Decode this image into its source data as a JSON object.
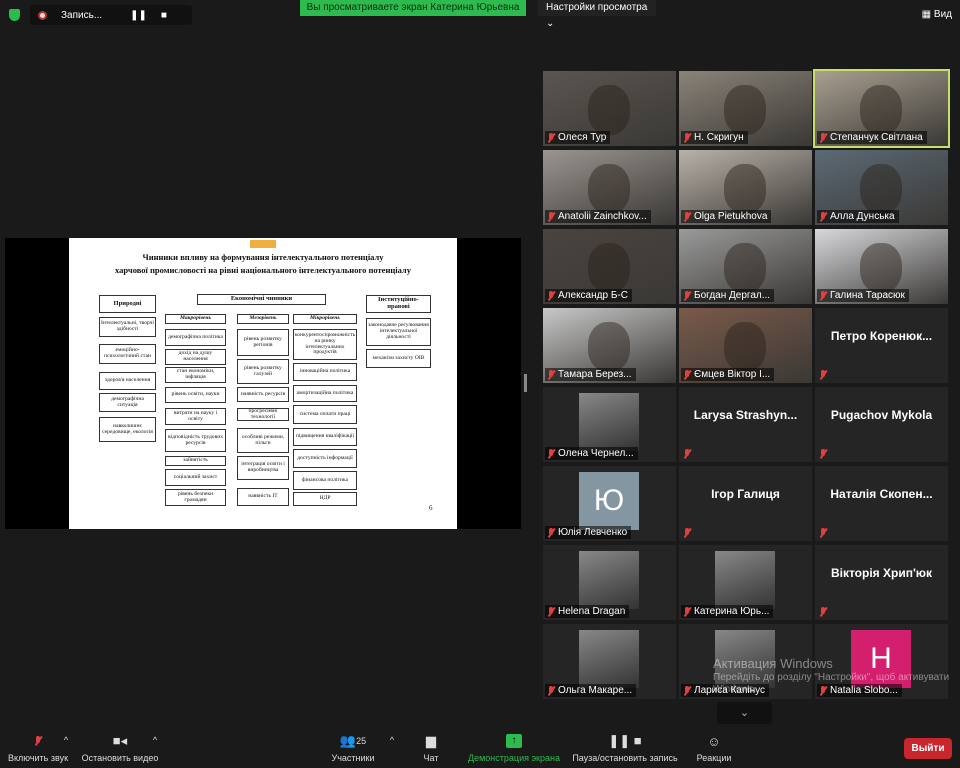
{
  "topbar": {
    "recording": "Запись...",
    "banner": "Вы просматриваете экран Катерина Юрьевна",
    "view_settings": "Настройки просмотра",
    "view": "Вид"
  },
  "slide": {
    "title1": "Чинники впливу на формування інтелектуального потенціалу",
    "title2": "харчової промисловості на рівні національного інтелектуального потенціалу",
    "page": "6",
    "boxes": [
      "Природні",
      "Економічні чинники",
      "Інституційно-правові",
      "Інтелектуальні, творчі здібності",
      "емоційно-психологічний стан",
      "здоров'я населення",
      "демографічна ситуація",
      "навколишнє середовище, екологія",
      "Макрорівень",
      "демографічна політика",
      "дохід на душу населення",
      "стан економіки, інфляція",
      "рівень освіти, науки",
      "витрати на науку і освіту",
      "відповідність трудових ресурсів",
      "зайнятість",
      "соціальний захист",
      "рівень безпеки громадян",
      "Мезорівень",
      "рівень розвитку регіонів",
      "рівень розвитку галузей",
      "наявність ресурсів",
      "прогресивні технології",
      "особливі режими, пільги",
      "інтеграція освіти і виробництва",
      "наявність ІТ",
      "Мікрорівень",
      "конкурентоспроможність на ринку інтелектуальних продуктів",
      "інноваційна політика",
      "амортизаційна політика",
      "система оплати праці",
      "підвищення кваліфікації",
      "доступність інформації",
      "фінансова політика",
      "НДР",
      "законодавче регулювання інтелектуальної діяльності",
      "механізм захисту ОІВ"
    ]
  },
  "participants": [
    {
      "name": "Олеся Тур",
      "type": "video"
    },
    {
      "name": "Н. Скригун",
      "type": "video"
    },
    {
      "name": "Степанчук Світлана",
      "type": "video",
      "active": true
    },
    {
      "name": "Anatolii Zainchkov...",
      "type": "video"
    },
    {
      "name": "Olga Pietukhova",
      "type": "video"
    },
    {
      "name": "Алла Дунська",
      "type": "video"
    },
    {
      "name": "Александр Б-С",
      "type": "video"
    },
    {
      "name": "Богдан Дергал...",
      "type": "video"
    },
    {
      "name": "Галина Тарасюк",
      "type": "video"
    },
    {
      "name": "Тамара Берез...",
      "type": "video"
    },
    {
      "name": "Ємцев Віктор І...",
      "type": "video"
    },
    {
      "name": "Петро Коренюк...",
      "type": "nameonly"
    },
    {
      "name": "Олена Чернел...",
      "type": "photo"
    },
    {
      "name": "Larysa Strashyn...",
      "type": "nameonly"
    },
    {
      "name": "Pugachov Mykola",
      "type": "nameonly"
    },
    {
      "name": "Юлія Левченко",
      "type": "avatar",
      "letter": "Ю",
      "color": "#8596a3"
    },
    {
      "name": "Ігор Галиця",
      "type": "nameonly"
    },
    {
      "name": "Наталія Скопен...",
      "type": "nameonly"
    },
    {
      "name": "Helena Dragan",
      "type": "photo"
    },
    {
      "name": "Катерина Юрь...",
      "type": "photo"
    },
    {
      "name": "Вікторія Хрип'юк",
      "type": "nameonly"
    },
    {
      "name": "Ольга Макаре...",
      "type": "photo"
    },
    {
      "name": "Лариса Капінус",
      "type": "photo"
    },
    {
      "name": "Natalia Slobo...",
      "type": "avatar",
      "letter": "H",
      "color": "#d41f6e"
    }
  ],
  "watermark": {
    "title": "Активация Windows",
    "sub": "Перейдіть до розділу \"Настройки\", щоб активувати Windows."
  },
  "toolbar": {
    "unmute": "Включить звук",
    "stop_video": "Остановить видео",
    "participants": "Участники",
    "participants_count": "25",
    "chat": "Чат",
    "share": "Демонстрация экрана",
    "pause_rec": "Пауза/остановить запись",
    "reactions": "Реакции",
    "leave": "Выйти"
  },
  "colors": {
    "green": "#2dbb4f",
    "leave": "#c8252c"
  }
}
